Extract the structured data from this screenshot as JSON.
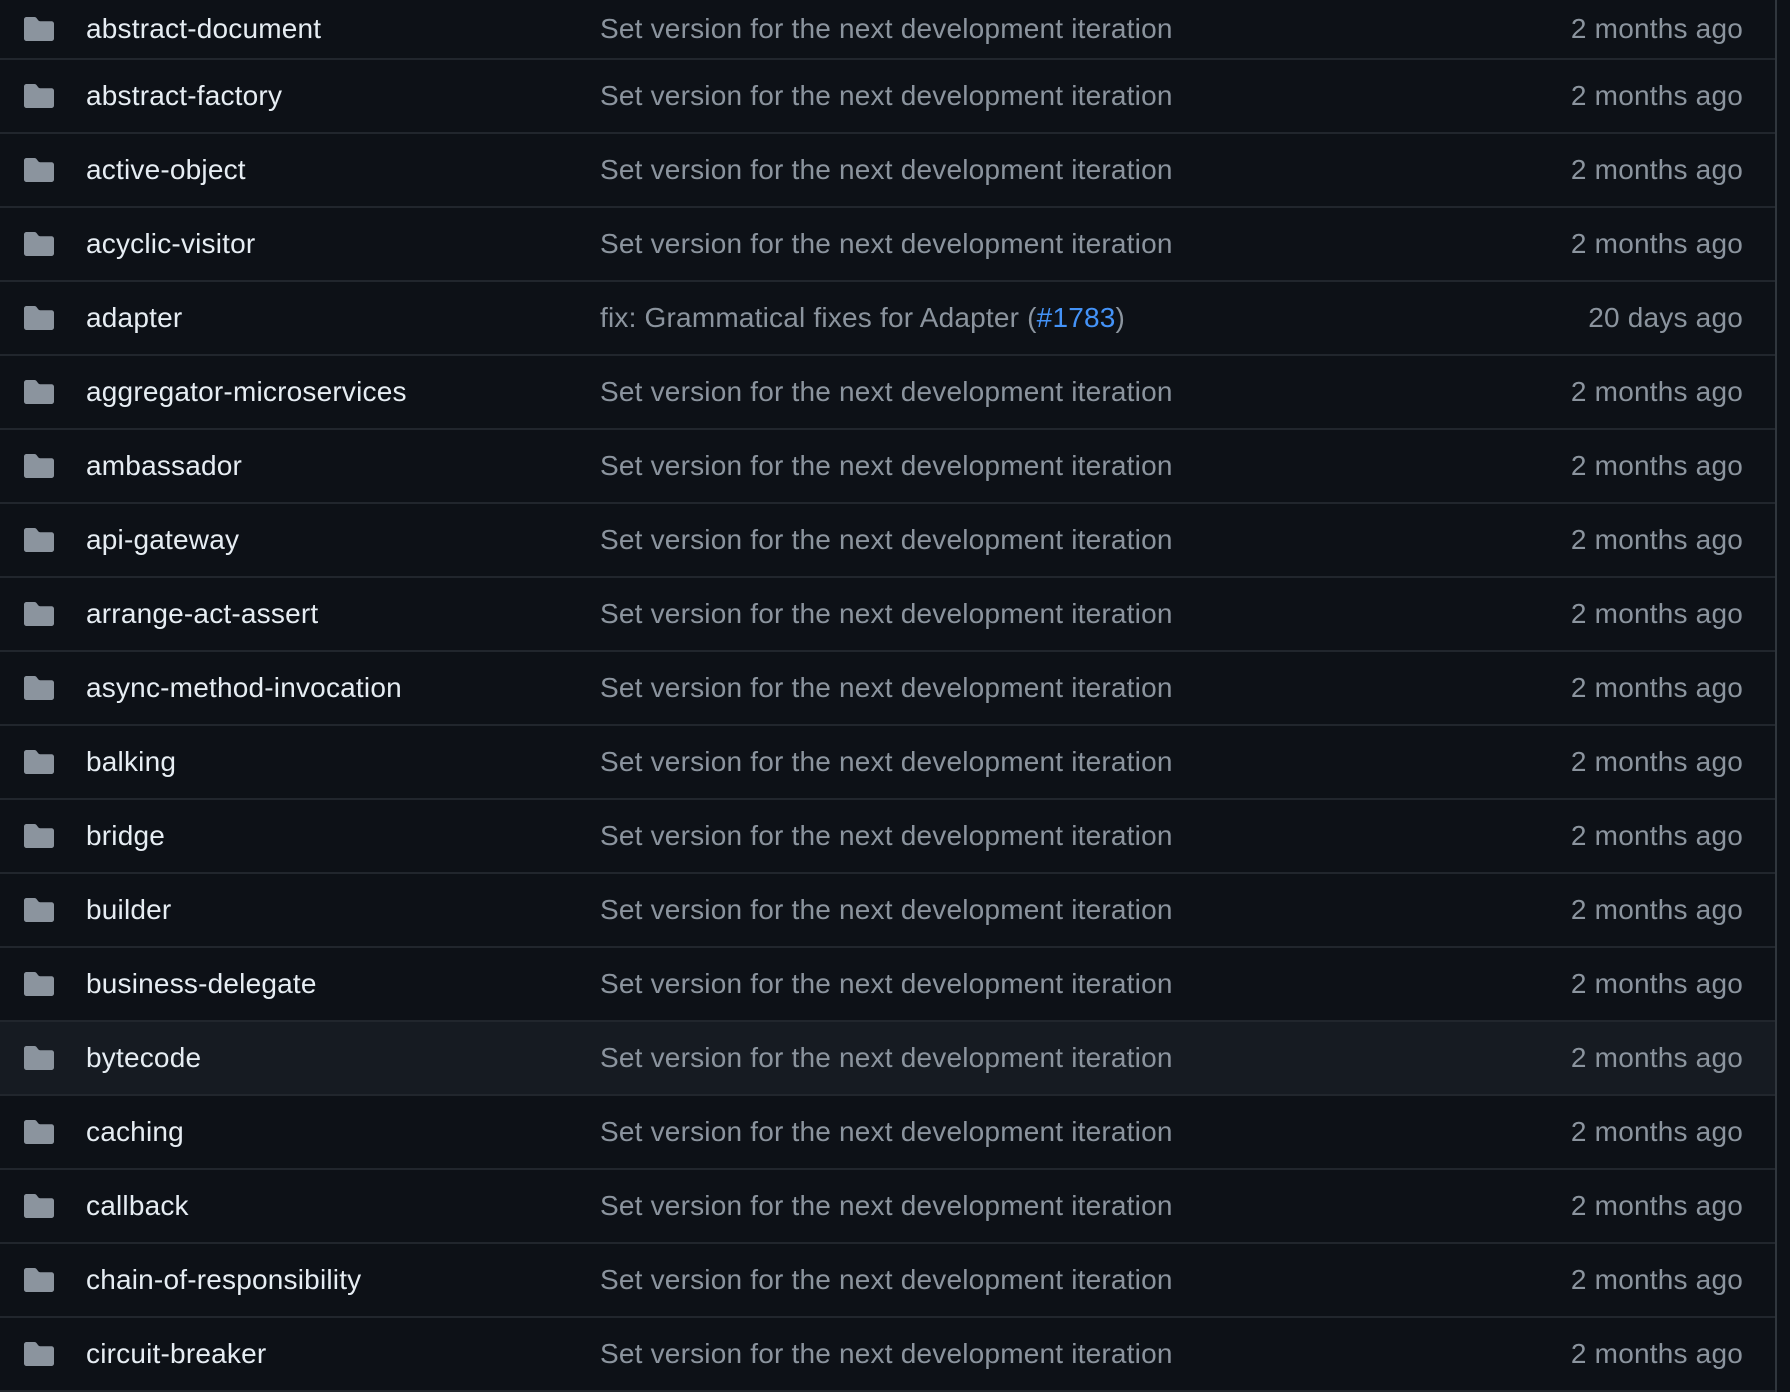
{
  "theme": {
    "background": "#0d1117",
    "row_hover": "#161b22",
    "text_primary": "#e6edf3",
    "text_muted": "#8b949e",
    "link": "#4493f8",
    "icon_color": "#8b949e"
  },
  "icon": "folder-icon",
  "rows": [
    {
      "name": "abstract-document",
      "commit": "Set version for the next development iteration",
      "age": "2 months ago"
    },
    {
      "name": "abstract-factory",
      "commit": "Set version for the next development iteration",
      "age": "2 months ago"
    },
    {
      "name": "active-object",
      "commit": "Set version for the next development iteration",
      "age": "2 months ago"
    },
    {
      "name": "acyclic-visitor",
      "commit": "Set version for the next development iteration",
      "age": "2 months ago"
    },
    {
      "name": "adapter",
      "commit": "fix: Grammatical fixes for Adapter (",
      "commit_link": "#1783",
      "commit_suffix": ")",
      "age": "20 days ago"
    },
    {
      "name": "aggregator-microservices",
      "commit": "Set version for the next development iteration",
      "age": "2 months ago"
    },
    {
      "name": "ambassador",
      "commit": "Set version for the next development iteration",
      "age": "2 months ago"
    },
    {
      "name": "api-gateway",
      "commit": "Set version for the next development iteration",
      "age": "2 months ago"
    },
    {
      "name": "arrange-act-assert",
      "commit": "Set version for the next development iteration",
      "age": "2 months ago"
    },
    {
      "name": "async-method-invocation",
      "commit": "Set version for the next development iteration",
      "age": "2 months ago"
    },
    {
      "name": "balking",
      "commit": "Set version for the next development iteration",
      "age": "2 months ago"
    },
    {
      "name": "bridge",
      "commit": "Set version for the next development iteration",
      "age": "2 months ago"
    },
    {
      "name": "builder",
      "commit": "Set version for the next development iteration",
      "age": "2 months ago"
    },
    {
      "name": "business-delegate",
      "commit": "Set version for the next development iteration",
      "age": "2 months ago"
    },
    {
      "name": "bytecode",
      "commit": "Set version for the next development iteration",
      "age": "2 months ago",
      "hover": true
    },
    {
      "name": "caching",
      "commit": "Set version for the next development iteration",
      "age": "2 months ago"
    },
    {
      "name": "callback",
      "commit": "Set version for the next development iteration",
      "age": "2 months ago"
    },
    {
      "name": "chain-of-responsibility",
      "commit": "Set version for the next development iteration",
      "age": "2 months ago"
    },
    {
      "name": "circuit-breaker",
      "commit": "Set version for the next development iteration",
      "age": "2 months ago"
    }
  ]
}
